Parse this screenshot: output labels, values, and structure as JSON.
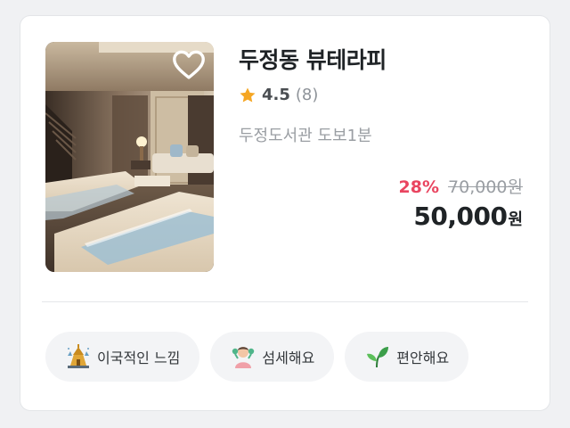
{
  "listing": {
    "title": "두정동 뷰테라피",
    "rating": "4.5",
    "review_count": "(8)",
    "location": "두정도서관 도보1분",
    "discount": "28%",
    "original_price": "70,000원",
    "price": "50,000",
    "price_unit": "원",
    "favorite_icon": "heart-outline-icon",
    "star_icon": "star-icon"
  },
  "tags": [
    {
      "label": "이국적인 느낌",
      "icon": "temple-icon"
    },
    {
      "label": "섬세해요",
      "icon": "massage-person-icon"
    },
    {
      "label": "편안해요",
      "icon": "leaf-icon"
    }
  ],
  "colors": {
    "star": "#f5a623",
    "discount": "#e94560",
    "tag_background": "#f3f4f6"
  }
}
